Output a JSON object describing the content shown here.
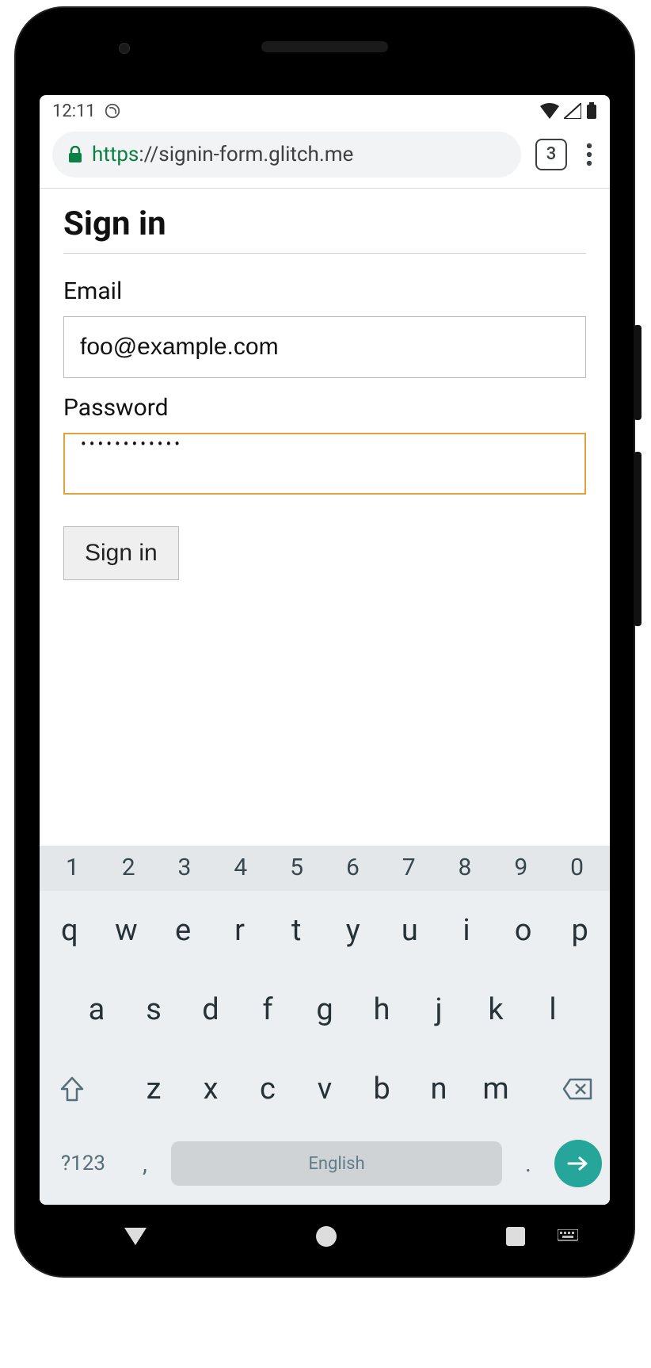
{
  "statusbar": {
    "time": "12:11"
  },
  "browser": {
    "url_scheme": "https",
    "url_sep": "://",
    "url_host": "signin-form.glitch.me",
    "tab_count": "3"
  },
  "page": {
    "title": "Sign in",
    "email_label": "Email",
    "email_value": "foo@example.com",
    "password_label": "Password",
    "password_masked": "••••••••••••",
    "submit_label": "Sign in"
  },
  "keyboard": {
    "numbers": [
      "1",
      "2",
      "3",
      "4",
      "5",
      "6",
      "7",
      "8",
      "9",
      "0"
    ],
    "row1": [
      "q",
      "w",
      "e",
      "r",
      "t",
      "y",
      "u",
      "i",
      "o",
      "p"
    ],
    "row2": [
      "a",
      "s",
      "d",
      "f",
      "g",
      "h",
      "j",
      "k",
      "l"
    ],
    "row3": [
      "z",
      "x",
      "c",
      "v",
      "b",
      "n",
      "m"
    ],
    "symbols_label": "?123",
    "comma": ",",
    "period": ".",
    "space_label": "English"
  }
}
